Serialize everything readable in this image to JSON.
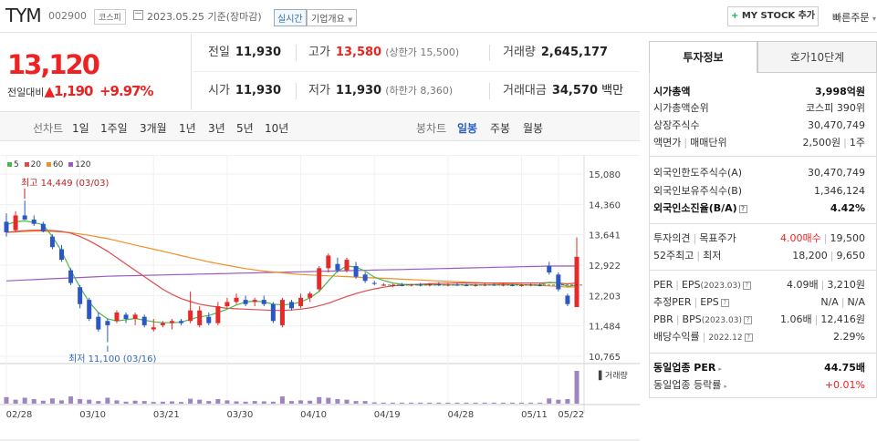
{
  "header": {
    "name": "TYM",
    "code": "002900",
    "market": "코스피",
    "date": "2023.05.25 기준(장마감)",
    "live": "실시간",
    "company_info": "기업개요",
    "my_stock": "MY STOCK 추가",
    "quick_order": "빠른주문"
  },
  "price": {
    "current": "13,120",
    "change_label": "전일대비",
    "change": "1,190",
    "change_pct": "+9.97%"
  },
  "quote": {
    "prev_label": "전일",
    "prev": "11,930",
    "high_label": "고가",
    "high": "13,580",
    "upper_limit": "(상한가 15,500)",
    "volume_label": "거래량",
    "volume": "2,645,177",
    "open_label": "시가",
    "open": "11,930",
    "low_label": "저가",
    "low": "11,930",
    "lower_limit": "(하한가 8,360)",
    "amount_label": "거래대금",
    "amount": "34,570",
    "amount_unit": "백만"
  },
  "period": {
    "line": "선차트",
    "line_tabs": [
      "1일",
      "1주일",
      "3개월",
      "1년",
      "3년",
      "5년",
      "10년"
    ],
    "candle": "봉차트",
    "candle_tabs": [
      "일봉",
      "주봉",
      "월봉"
    ],
    "active": "일봉"
  },
  "colors": {
    "up": "#e62a2a",
    "down": "#2a56c6",
    "ma5": "#4cb848",
    "ma20": "#e24a4a",
    "ma60": "#f08f25",
    "ma120": "#9b5bc4",
    "volume": "#9f86c0"
  },
  "chart_data": {
    "type": "candlestick",
    "moving_averages": [
      "5",
      "20",
      "60",
      "120"
    ],
    "y_ticks": [
      "15,080",
      "14,360",
      "13,641",
      "12,922",
      "12,203",
      "11,484",
      "10,765"
    ],
    "ylim": [
      10765,
      15080
    ],
    "x_ticks": [
      "02/28",
      "03/10",
      "03/21",
      "03/30",
      "04/10",
      "04/19",
      "04/28",
      "05/11",
      "05/22"
    ],
    "high_annotation": "최고 14,449 (03/03)",
    "low_annotation": "최저 11,100 (03/16)",
    "volume_label": "거래량",
    "candles": [
      {
        "o": 13950,
        "h": 14150,
        "l": 13600,
        "c": 13700
      },
      {
        "o": 13750,
        "h": 14200,
        "l": 13700,
        "c": 14100
      },
      {
        "o": 14100,
        "h": 14449,
        "l": 14000,
        "c": 14000
      },
      {
        "o": 14000,
        "h": 14100,
        "l": 13850,
        "c": 13900
      },
      {
        "o": 13900,
        "h": 13950,
        "l": 13700,
        "c": 13720
      },
      {
        "o": 13600,
        "h": 13650,
        "l": 13300,
        "c": 13350
      },
      {
        "o": 13300,
        "h": 13400,
        "l": 13000,
        "c": 13050
      },
      {
        "o": 12800,
        "h": 12850,
        "l": 12450,
        "c": 12500
      },
      {
        "o": 12400,
        "h": 12450,
        "l": 11900,
        "c": 12000
      },
      {
        "o": 12100,
        "h": 12150,
        "l": 11600,
        "c": 11650
      },
      {
        "o": 11700,
        "h": 11800,
        "l": 11350,
        "c": 11400
      },
      {
        "o": 11600,
        "h": 11650,
        "l": 11100,
        "c": 11500
      },
      {
        "o": 11600,
        "h": 11850,
        "l": 11550,
        "c": 11800
      },
      {
        "o": 11750,
        "h": 11800,
        "l": 11550,
        "c": 11650
      },
      {
        "o": 11650,
        "h": 11800,
        "l": 11500,
        "c": 11750
      },
      {
        "o": 11700,
        "h": 11750,
        "l": 11450,
        "c": 11500
      },
      {
        "o": 11400,
        "h": 11650,
        "l": 11350,
        "c": 11450
      },
      {
        "o": 11500,
        "h": 11600,
        "l": 11450,
        "c": 11550
      },
      {
        "o": 11550,
        "h": 11650,
        "l": 11400,
        "c": 11600
      },
      {
        "o": 11600,
        "h": 11650,
        "l": 11500,
        "c": 11550
      },
      {
        "o": 11600,
        "h": 12300,
        "l": 11550,
        "c": 11850
      },
      {
        "o": 11500,
        "h": 11950,
        "l": 11450,
        "c": 11850
      },
      {
        "o": 11700,
        "h": 11800,
        "l": 11500,
        "c": 11550
      },
      {
        "o": 11550,
        "h": 12050,
        "l": 11500,
        "c": 11950
      },
      {
        "o": 11950,
        "h": 12150,
        "l": 11900,
        "c": 12050
      },
      {
        "o": 12050,
        "h": 12250,
        "l": 12000,
        "c": 12150
      },
      {
        "o": 12100,
        "h": 12200,
        "l": 11950,
        "c": 12000
      },
      {
        "o": 12050,
        "h": 12150,
        "l": 11950,
        "c": 12100
      },
      {
        "o": 12100,
        "h": 12200,
        "l": 11950,
        "c": 12000
      },
      {
        "o": 12000,
        "h": 12050,
        "l": 11550,
        "c": 11600
      },
      {
        "o": 11500,
        "h": 12150,
        "l": 11450,
        "c": 12100
      },
      {
        "o": 12050,
        "h": 12100,
        "l": 11850,
        "c": 11900
      },
      {
        "o": 11950,
        "h": 12250,
        "l": 11900,
        "c": 12150
      },
      {
        "o": 12150,
        "h": 12300,
        "l": 12050,
        "c": 12250
      },
      {
        "o": 12350,
        "h": 12900,
        "l": 12300,
        "c": 12850
      },
      {
        "o": 12850,
        "h": 13200,
        "l": 12750,
        "c": 13150
      },
      {
        "o": 12950,
        "h": 13100,
        "l": 12750,
        "c": 12800
      },
      {
        "o": 12800,
        "h": 13100,
        "l": 12750,
        "c": 13050
      },
      {
        "o": 12900,
        "h": 13000,
        "l": 12600,
        "c": 12650
      },
      {
        "o": 12700,
        "h": 12750,
        "l": 12500,
        "c": 12550
      },
      {
        "o": 12500,
        "h": 12550,
        "l": 12450,
        "c": 12480
      },
      {
        "o": 12450,
        "h": 12500,
        "l": 12430,
        "c": 12460
      },
      {
        "o": 12430,
        "h": 12480,
        "l": 12400,
        "c": 12450
      },
      {
        "o": 12450,
        "h": 12500,
        "l": 12420,
        "c": 12440
      },
      {
        "o": 12440,
        "h": 12480,
        "l": 12420,
        "c": 12460
      },
      {
        "o": 12460,
        "h": 12500,
        "l": 12420,
        "c": 12450
      },
      {
        "o": 12450,
        "h": 12500,
        "l": 12420,
        "c": 12470
      },
      {
        "o": 12470,
        "h": 12520,
        "l": 12430,
        "c": 12450
      },
      {
        "o": 12450,
        "h": 12500,
        "l": 12420,
        "c": 12460
      },
      {
        "o": 12460,
        "h": 12500,
        "l": 12430,
        "c": 12450
      },
      {
        "o": 12450,
        "h": 12480,
        "l": 12420,
        "c": 12440
      },
      {
        "o": 12440,
        "h": 12480,
        "l": 12410,
        "c": 12450
      },
      {
        "o": 12450,
        "h": 12500,
        "l": 12420,
        "c": 12460
      },
      {
        "o": 12460,
        "h": 12480,
        "l": 12430,
        "c": 12450
      },
      {
        "o": 12450,
        "h": 12500,
        "l": 12420,
        "c": 12460
      },
      {
        "o": 12450,
        "h": 12480,
        "l": 12420,
        "c": 12440
      },
      {
        "o": 12440,
        "h": 12470,
        "l": 12410,
        "c": 12450
      },
      {
        "o": 12450,
        "h": 12480,
        "l": 12420,
        "c": 12460
      },
      {
        "o": 12450,
        "h": 12490,
        "l": 12420,
        "c": 12440
      },
      {
        "o": 12900,
        "h": 13000,
        "l": 12700,
        "c": 12750
      },
      {
        "o": 12700,
        "h": 12750,
        "l": 12300,
        "c": 12350
      },
      {
        "o": 12200,
        "h": 12250,
        "l": 11950,
        "c": 12000
      },
      {
        "o": 11930,
        "h": 13580,
        "l": 11930,
        "c": 13120
      }
    ],
    "volumes": [
      20,
      12,
      18,
      14,
      9,
      16,
      10,
      22,
      14,
      12,
      8,
      18,
      10,
      6,
      9,
      8,
      5,
      6,
      7,
      5,
      15,
      12,
      8,
      14,
      10,
      7,
      6,
      8,
      7,
      6,
      22,
      8,
      10,
      9,
      20,
      18,
      14,
      12,
      8,
      8,
      4,
      3,
      3,
      3,
      3,
      3,
      3,
      3,
      3,
      3,
      3,
      3,
      3,
      3,
      3,
      3,
      3,
      3,
      3,
      16,
      12,
      14,
      100
    ],
    "ma5": [
      13880,
      13950,
      13970,
      13930,
      13880,
      13600,
      13250,
      12800,
      12400,
      12050,
      11800,
      11650,
      11600,
      11630,
      11660,
      11620,
      11580,
      11560,
      11560,
      11570,
      11640,
      11700,
      11730,
      11800,
      11880,
      11980,
      12050,
      12070,
      12050,
      12000,
      11980,
      12000,
      12050,
      12150,
      12300,
      12550,
      12780,
      12900,
      12880,
      12780,
      12640,
      12560,
      12500,
      12470,
      12460,
      12455,
      12455,
      12455,
      12455,
      12455,
      12455,
      12455,
      12455,
      12455,
      12455,
      12455,
      12455,
      12455,
      12455,
      12520,
      12500,
      12420,
      12450
    ],
    "ma20": [
      13700,
      13720,
      13740,
      13750,
      13750,
      13740,
      13720,
      13680,
      13600,
      13500,
      13380,
      13250,
      13100,
      12950,
      12800,
      12650,
      12500,
      12350,
      12230,
      12130,
      12060,
      12000,
      11960,
      11930,
      11900,
      11890,
      11880,
      11870,
      11860,
      11850,
      11850,
      11860,
      11880,
      11910,
      11960,
      12020,
      12100,
      12180,
      12250,
      12310,
      12360,
      12400,
      12430,
      12450,
      12460,
      12470,
      12480,
      12490,
      12495,
      12500,
      12500,
      12500,
      12500,
      12500,
      12500,
      12500,
      12500,
      12500,
      12500,
      12510,
      12500,
      12480,
      12500
    ],
    "ma60": [
      13700,
      13710,
      13720,
      13730,
      13730,
      13720,
      13710,
      13690,
      13660,
      13630,
      13590,
      13550,
      13500,
      13450,
      13400,
      13350,
      13300,
      13250,
      13200,
      13150,
      13100,
      13050,
      13000,
      12960,
      12920,
      12880,
      12840,
      12810,
      12780,
      12760,
      12740,
      12720,
      12700,
      12690,
      12680,
      12670,
      12660,
      12650,
      12640,
      12630,
      12620,
      12610,
      12600,
      12590,
      12580,
      12570,
      12560,
      12550,
      12540,
      12530,
      12520,
      12510,
      12500,
      12490,
      12480,
      12470,
      12460,
      12450,
      12440,
      12430,
      12420,
      12400,
      12410
    ],
    "ma120": [
      12550,
      12560,
      12570,
      12580,
      12590,
      12600,
      12610,
      12620,
      12630,
      12640,
      12650,
      12660,
      12665,
      12670,
      12675,
      12680,
      12685,
      12690,
      12695,
      12700,
      12705,
      12710,
      12715,
      12720,
      12725,
      12730,
      12735,
      12740,
      12745,
      12750,
      12755,
      12760,
      12765,
      12770,
      12775,
      12780,
      12785,
      12790,
      12795,
      12800,
      12805,
      12810,
      12815,
      12820,
      12825,
      12830,
      12835,
      12840,
      12845,
      12850,
      12855,
      12860,
      12865,
      12870,
      12875,
      12880,
      12885,
      12890,
      12895,
      12900,
      12900,
      12900,
      12900
    ]
  },
  "sidebar": {
    "tab_active": "투자정보",
    "tab_other": "호가10단계",
    "market_cap_label": "시가총액",
    "market_cap": "3,998억원",
    "rank_label": "시가총액순위",
    "rank": "코스피 390위",
    "shares_label": "상장주식수",
    "shares": "30,470,749",
    "par_label": "액면가",
    "unit_label": "매매단위",
    "par": "2,500원",
    "unit": "1주",
    "foreign_limit_label": "외국인한도주식수(A)",
    "foreign_limit": "30,470,749",
    "foreign_hold_label": "외국인보유주식수(B)",
    "foreign_hold": "1,346,124",
    "foreign_ratio_label": "외국인소진율(B/A)",
    "foreign_ratio": "4.42%",
    "opinion_label": "투자의견",
    "target_label": "목표주가",
    "opinion": "4.00매수",
    "target": "19,500",
    "week52_high_label": "52주최고",
    "week52_low_label": "최저",
    "week52_high": "18,200",
    "week52_low": "9,650",
    "per_label": "PER",
    "eps_label": "EPS",
    "per_period": "(2023.03)",
    "per": "4.09배",
    "eps": "3,210원",
    "est_per_label": "추정PER",
    "est_eps_label": "EPS",
    "est_per": "N/A",
    "est_eps": "N/A",
    "pbr_label": "PBR",
    "bps_label": "BPS",
    "pbr_period": "(2023.03)",
    "pbr": "1.06배",
    "bps": "12,416원",
    "div_label": "배당수익률",
    "div_period": "2022.12",
    "div": "2.29%",
    "ind_per_label": "동일업종 PER",
    "ind_per": "44.75배",
    "ind_rate_label": "동일업종 등락률",
    "ind_rate": "+0.01%"
  }
}
